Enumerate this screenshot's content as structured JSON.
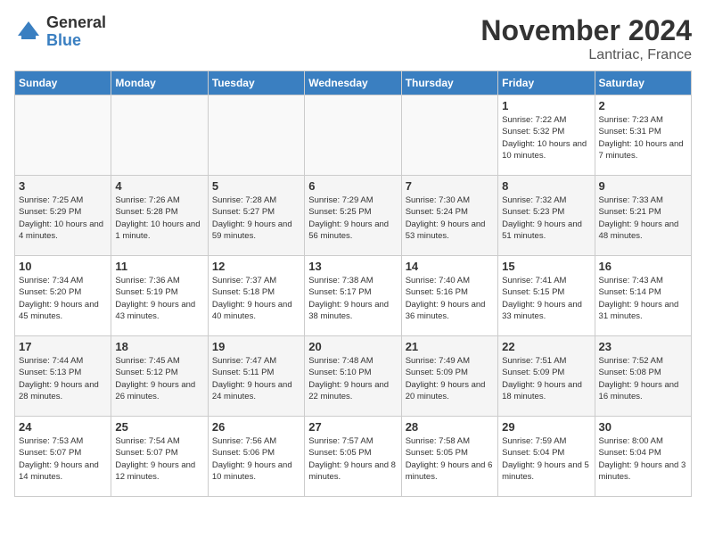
{
  "logo": {
    "general": "General",
    "blue": "Blue"
  },
  "title": "November 2024",
  "location": "Lantriac, France",
  "days_of_week": [
    "Sunday",
    "Monday",
    "Tuesday",
    "Wednesday",
    "Thursday",
    "Friday",
    "Saturday"
  ],
  "weeks": [
    [
      {
        "day": "",
        "info": ""
      },
      {
        "day": "",
        "info": ""
      },
      {
        "day": "",
        "info": ""
      },
      {
        "day": "",
        "info": ""
      },
      {
        "day": "",
        "info": ""
      },
      {
        "day": "1",
        "info": "Sunrise: 7:22 AM\nSunset: 5:32 PM\nDaylight: 10 hours and 10 minutes."
      },
      {
        "day": "2",
        "info": "Sunrise: 7:23 AM\nSunset: 5:31 PM\nDaylight: 10 hours and 7 minutes."
      }
    ],
    [
      {
        "day": "3",
        "info": "Sunrise: 7:25 AM\nSunset: 5:29 PM\nDaylight: 10 hours and 4 minutes."
      },
      {
        "day": "4",
        "info": "Sunrise: 7:26 AM\nSunset: 5:28 PM\nDaylight: 10 hours and 1 minute."
      },
      {
        "day": "5",
        "info": "Sunrise: 7:28 AM\nSunset: 5:27 PM\nDaylight: 9 hours and 59 minutes."
      },
      {
        "day": "6",
        "info": "Sunrise: 7:29 AM\nSunset: 5:25 PM\nDaylight: 9 hours and 56 minutes."
      },
      {
        "day": "7",
        "info": "Sunrise: 7:30 AM\nSunset: 5:24 PM\nDaylight: 9 hours and 53 minutes."
      },
      {
        "day": "8",
        "info": "Sunrise: 7:32 AM\nSunset: 5:23 PM\nDaylight: 9 hours and 51 minutes."
      },
      {
        "day": "9",
        "info": "Sunrise: 7:33 AM\nSunset: 5:21 PM\nDaylight: 9 hours and 48 minutes."
      }
    ],
    [
      {
        "day": "10",
        "info": "Sunrise: 7:34 AM\nSunset: 5:20 PM\nDaylight: 9 hours and 45 minutes."
      },
      {
        "day": "11",
        "info": "Sunrise: 7:36 AM\nSunset: 5:19 PM\nDaylight: 9 hours and 43 minutes."
      },
      {
        "day": "12",
        "info": "Sunrise: 7:37 AM\nSunset: 5:18 PM\nDaylight: 9 hours and 40 minutes."
      },
      {
        "day": "13",
        "info": "Sunrise: 7:38 AM\nSunset: 5:17 PM\nDaylight: 9 hours and 38 minutes."
      },
      {
        "day": "14",
        "info": "Sunrise: 7:40 AM\nSunset: 5:16 PM\nDaylight: 9 hours and 36 minutes."
      },
      {
        "day": "15",
        "info": "Sunrise: 7:41 AM\nSunset: 5:15 PM\nDaylight: 9 hours and 33 minutes."
      },
      {
        "day": "16",
        "info": "Sunrise: 7:43 AM\nSunset: 5:14 PM\nDaylight: 9 hours and 31 minutes."
      }
    ],
    [
      {
        "day": "17",
        "info": "Sunrise: 7:44 AM\nSunset: 5:13 PM\nDaylight: 9 hours and 28 minutes."
      },
      {
        "day": "18",
        "info": "Sunrise: 7:45 AM\nSunset: 5:12 PM\nDaylight: 9 hours and 26 minutes."
      },
      {
        "day": "19",
        "info": "Sunrise: 7:47 AM\nSunset: 5:11 PM\nDaylight: 9 hours and 24 minutes."
      },
      {
        "day": "20",
        "info": "Sunrise: 7:48 AM\nSunset: 5:10 PM\nDaylight: 9 hours and 22 minutes."
      },
      {
        "day": "21",
        "info": "Sunrise: 7:49 AM\nSunset: 5:09 PM\nDaylight: 9 hours and 20 minutes."
      },
      {
        "day": "22",
        "info": "Sunrise: 7:51 AM\nSunset: 5:09 PM\nDaylight: 9 hours and 18 minutes."
      },
      {
        "day": "23",
        "info": "Sunrise: 7:52 AM\nSunset: 5:08 PM\nDaylight: 9 hours and 16 minutes."
      }
    ],
    [
      {
        "day": "24",
        "info": "Sunrise: 7:53 AM\nSunset: 5:07 PM\nDaylight: 9 hours and 14 minutes."
      },
      {
        "day": "25",
        "info": "Sunrise: 7:54 AM\nSunset: 5:07 PM\nDaylight: 9 hours and 12 minutes."
      },
      {
        "day": "26",
        "info": "Sunrise: 7:56 AM\nSunset: 5:06 PM\nDaylight: 9 hours and 10 minutes."
      },
      {
        "day": "27",
        "info": "Sunrise: 7:57 AM\nSunset: 5:05 PM\nDaylight: 9 hours and 8 minutes."
      },
      {
        "day": "28",
        "info": "Sunrise: 7:58 AM\nSunset: 5:05 PM\nDaylight: 9 hours and 6 minutes."
      },
      {
        "day": "29",
        "info": "Sunrise: 7:59 AM\nSunset: 5:04 PM\nDaylight: 9 hours and 5 minutes."
      },
      {
        "day": "30",
        "info": "Sunrise: 8:00 AM\nSunset: 5:04 PM\nDaylight: 9 hours and 3 minutes."
      }
    ]
  ]
}
